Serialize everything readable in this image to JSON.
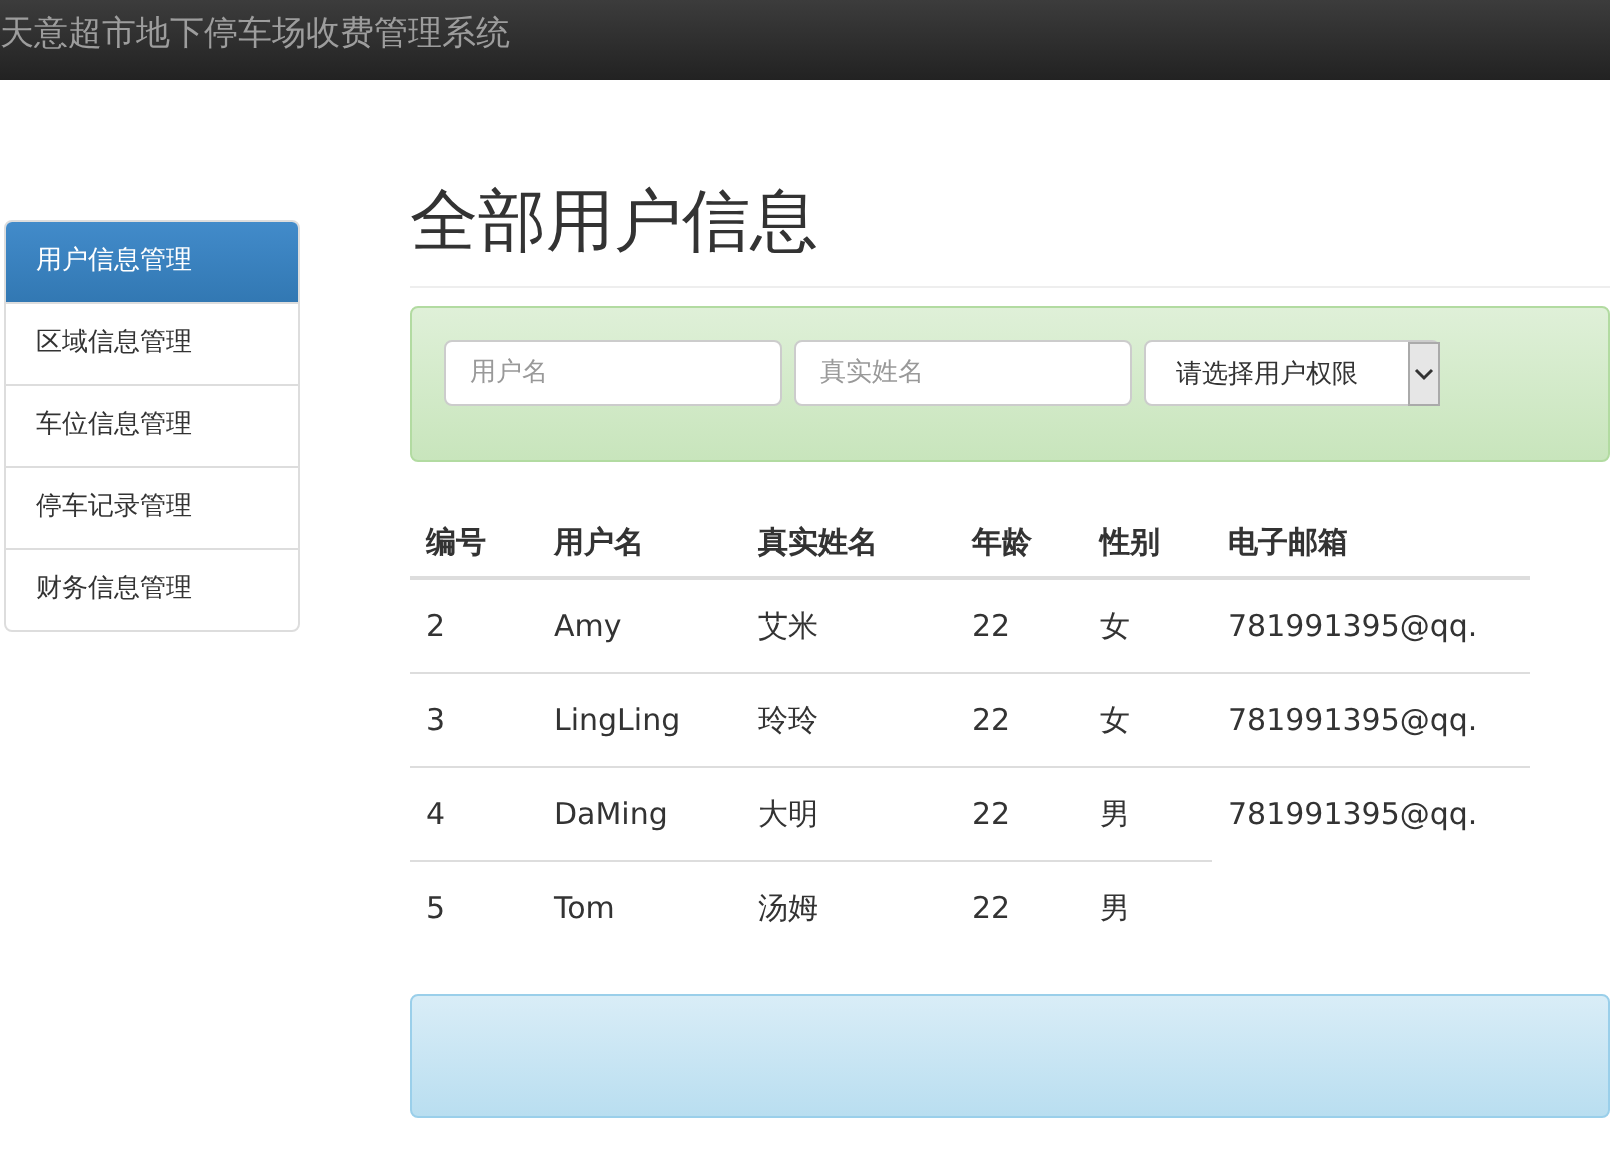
{
  "navbar": {
    "title": "天意超市地下停车场收费管理系统"
  },
  "sidebar": {
    "items": [
      {
        "label": "用户信息管理",
        "selected": true
      },
      {
        "label": "区域信息管理",
        "selected": false
      },
      {
        "label": "车位信息管理",
        "selected": false
      },
      {
        "label": "停车记录管理",
        "selected": false
      },
      {
        "label": "财务信息管理",
        "selected": false
      }
    ]
  },
  "page_title": "全部用户信息",
  "filters": {
    "username": {
      "placeholder": "用户名"
    },
    "realname": {
      "placeholder": "真实姓名"
    },
    "permission": {
      "value": "请选择用户权限"
    }
  },
  "table": {
    "columns": [
      "编号",
      "用户名",
      "真实姓名",
      "年龄",
      "性别",
      "电子邮箱"
    ],
    "rows": [
      [
        "2",
        "Amy",
        "艾米",
        "22",
        "女",
        "781991395@qq."
      ],
      [
        "3",
        "LingLing",
        "玲玲",
        "22",
        "女",
        "781991395@qq."
      ],
      [
        "4",
        "DaMing",
        "大明",
        "22",
        "男",
        "781991395@qq."
      ],
      [
        "5",
        "Tom",
        "汤姆",
        "22",
        "男"
      ]
    ]
  }
}
